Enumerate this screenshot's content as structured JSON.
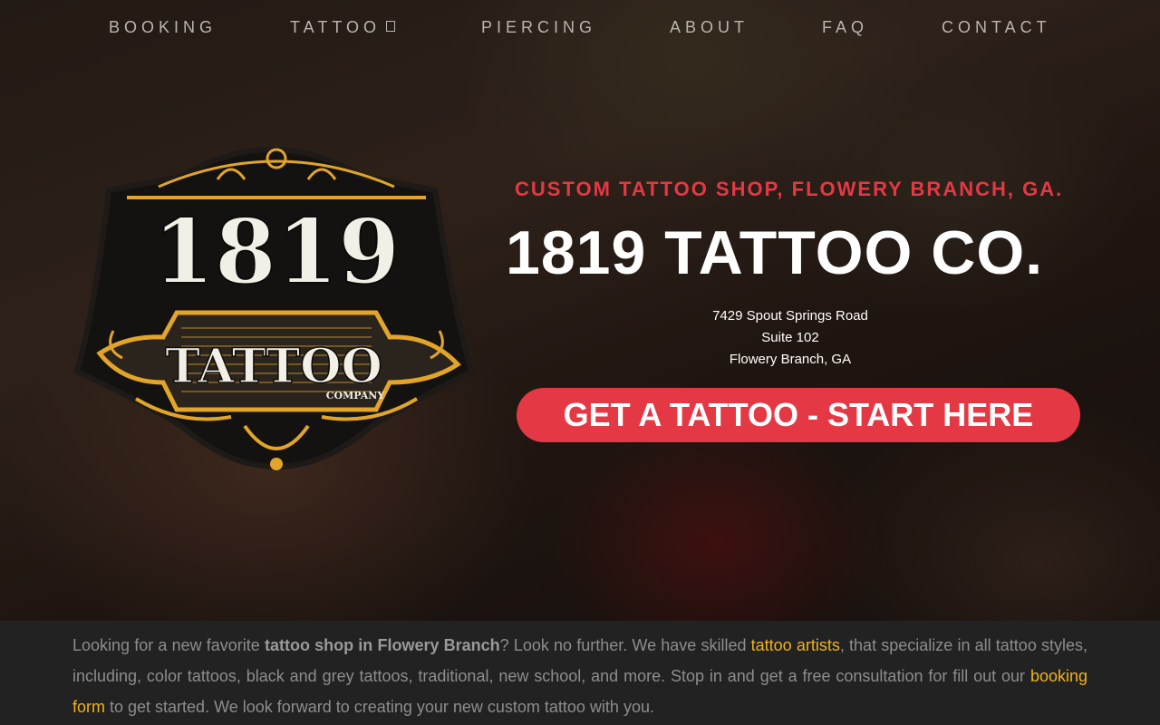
{
  "nav": {
    "items": [
      "BOOKING",
      "TATTOO",
      "PIERCING",
      "ABOUT",
      "FAQ",
      "CONTACT"
    ]
  },
  "logo": {
    "number": "1819",
    "word": "TATTOO",
    "sub": "COMPANY"
  },
  "hero": {
    "tagline": "CUSTOM TATTOO SHOP, FLOWERY BRANCH, GA.",
    "title": "1819 TATTOO CO.",
    "address": [
      "7429 Spout Springs Road",
      "Suite 102",
      "Flowery Branch, GA"
    ],
    "cta": "GET A TATTOO - START HERE"
  },
  "intro": {
    "t1": "Looking for a new favorite ",
    "b1": "tattoo shop in Flowery Branch",
    "t2": "? Look no further. We have skilled ",
    "link1": "tattoo artists",
    "t3": ", that specialize in all tattoo styles, including, color tattoos, black and grey tattoos, traditional, new school, and more.  Stop in and get a free consultation for fill out our ",
    "link2": "booking form",
    "t4": " to get started. We look forward to creating your new custom tattoo with you."
  },
  "colors": {
    "accent_red": "#e53845",
    "gold": "#f0b21c",
    "nav_text": "#b9b5b0",
    "section_bg": "#222222"
  },
  "icons": {
    "nav_tattoo_dropdown": "box-icon"
  }
}
